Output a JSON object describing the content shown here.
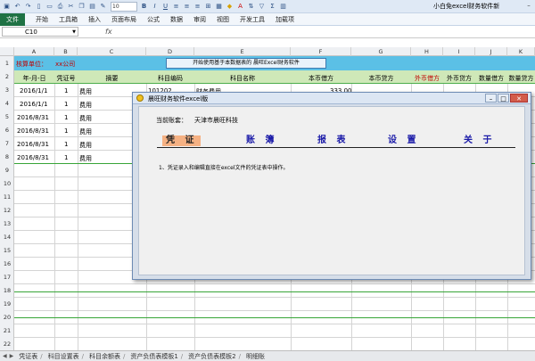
{
  "title_bar": {
    "font_size": "10",
    "title": "小白免excel财务软件新"
  },
  "ribbon": {
    "tabs": [
      "文件",
      "开始",
      "工具箱",
      "插入",
      "页面布局",
      "公式",
      "数据",
      "审阅",
      "视图",
      "开发工具",
      "加载项"
    ]
  },
  "formula_bar": {
    "name_box": "C10",
    "fx": "fx"
  },
  "columns": [
    "A",
    "B",
    "C",
    "D",
    "E",
    "F",
    "G",
    "H",
    "I",
    "J",
    "K"
  ],
  "rows": [
    "1",
    "2",
    "3",
    "4",
    "5",
    "6",
    "7",
    "8",
    "9",
    "10",
    "11",
    "12",
    "13",
    "14",
    "15",
    "16",
    "17",
    "18",
    "19",
    "20",
    "21",
    "22"
  ],
  "sheet": {
    "row1": {
      "label": "核算单位：",
      "unit": "xx公司",
      "banner": "开始使用基于本数据表的 晨旺Excel财务软件"
    },
    "headers": [
      "年-月-日",
      "凭证号",
      "摘要",
      "科目编码",
      "科目名称",
      "本币借方",
      "本币贷方",
      "外币借方",
      "外币贷方",
      "数量借方",
      "数量贷方"
    ],
    "data": [
      {
        "date": "2016/1/1",
        "no": "1",
        "memo": "费用",
        "code": "101202",
        "name": "财务费用",
        "debit": "333.00"
      },
      {
        "date": "2016/1/1",
        "no": "1",
        "memo": "费用"
      },
      {
        "date": "2016/8/31",
        "no": "1",
        "memo": "费用"
      },
      {
        "date": "2016/8/31",
        "no": "1",
        "memo": "费用"
      },
      {
        "date": "2016/8/31",
        "no": "1",
        "memo": "费用"
      },
      {
        "date": "2016/8/31",
        "no": "1",
        "memo": "费用"
      }
    ]
  },
  "dialog": {
    "title": "晨旺财务软件excel版",
    "account_label": "当前账套：",
    "account_value": "天津市晨旺科技",
    "menu": [
      "凭 证",
      "账 簿",
      "报 表",
      "设 置",
      "关 于"
    ],
    "note": "1、凭证录入和编辑直接在excel文件的凭证表中操作。"
  },
  "sheet_tabs": [
    "凭证表",
    "科目设置表",
    "科目余额表",
    "资产负债表模板1",
    "资产负债表模板2",
    "明细账"
  ]
}
